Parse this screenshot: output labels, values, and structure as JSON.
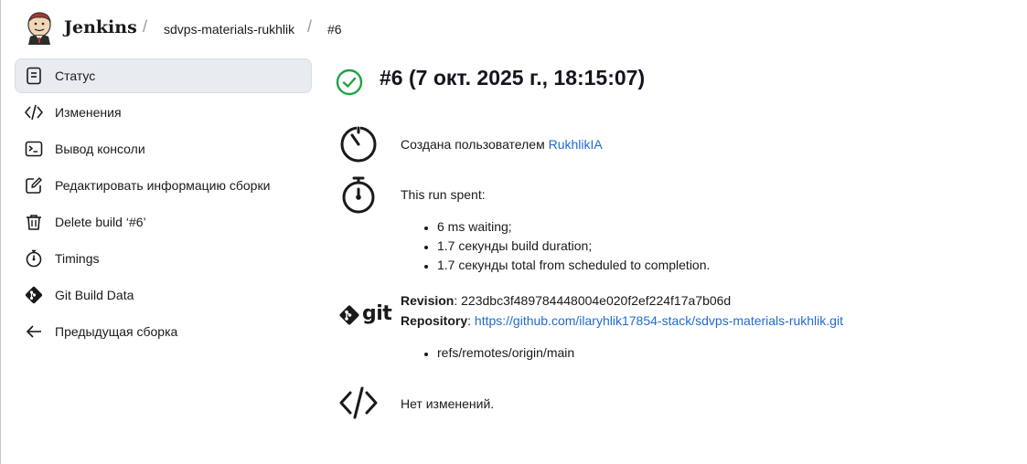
{
  "header": {
    "brand": "Jenkins",
    "breadcrumbs": [
      "sdvps-materials-rukhlik",
      "#6"
    ],
    "separator": "/"
  },
  "sidebar": {
    "items": [
      {
        "label": "Статус",
        "icon": "document-icon",
        "active": true
      },
      {
        "label": "Изменения",
        "icon": "code-icon",
        "active": false
      },
      {
        "label": "Вывод консоли",
        "icon": "terminal-icon",
        "active": false
      },
      {
        "label": "Редактировать информацию сборки",
        "icon": "edit-icon",
        "active": false
      },
      {
        "label": "Delete build ‘#6’",
        "icon": "trash-icon",
        "active": false
      },
      {
        "label": "Timings",
        "icon": "stopwatch-icon",
        "active": false
      },
      {
        "label": "Git Build Data",
        "icon": "git-icon",
        "active": false
      },
      {
        "label": "Предыдущая сборка",
        "icon": "arrow-left-icon",
        "active": false
      }
    ]
  },
  "main": {
    "title": "#6 (7 окт. 2025 г., 18:15:07)",
    "status_icon": "success-check-icon",
    "created_by": {
      "prefix": "Создана пользователем ",
      "user": "RukhlikIA"
    },
    "timing": {
      "heading": "This run spent:",
      "items": [
        "6 ms waiting;",
        "1.7 секунды build duration;",
        "1.7 секунды total from scheduled to completion."
      ]
    },
    "git": {
      "logo_text": "git",
      "revision_label": "Revision",
      "revision": "223dbc3f489784448004e020f2ef224f17a7b06d",
      "repository_label": "Repository",
      "repository": "https://github.com/ilaryhlik17854-stack/sdvps-materials-rukhlik.git",
      "branches": [
        "refs/remotes/origin/main"
      ]
    },
    "changes": {
      "text": "Нет изменений."
    }
  },
  "colors": {
    "accent_link": "#1f6bd1",
    "success": "#1ea446",
    "active_bg": "#e8ebf0"
  }
}
